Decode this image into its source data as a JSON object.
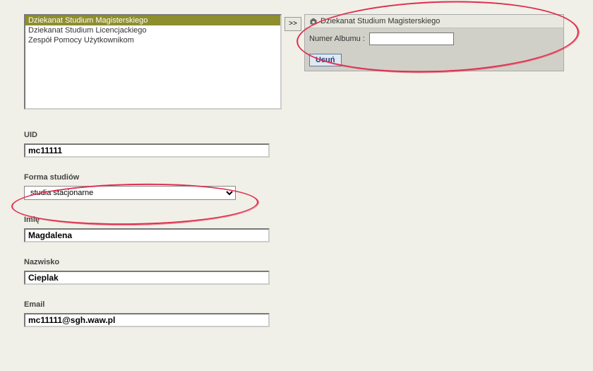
{
  "listbox": {
    "items": [
      {
        "label": "Dziekanat Studium Magisterskiego",
        "selected": true
      },
      {
        "label": "Dziekanat Studium Licencjackiego",
        "selected": false
      },
      {
        "label": "Zespół Pomocy Użytkownikom",
        "selected": false
      }
    ]
  },
  "move_button": {
    "label": ">>"
  },
  "right_panel": {
    "header_label": "Dziekanat Studium Magisterskiego",
    "album_label": "Numer Albumu :",
    "album_value": "",
    "delete_label": "Usuń"
  },
  "form": {
    "uid_label": "UID",
    "uid_value": "mc11111",
    "forma_label": "Forma studiów",
    "forma_value": "studia stacjonarne",
    "imie_label": "Imię",
    "imie_value": "Magdalena",
    "nazwisko_label": "Nazwisko",
    "nazwisko_value": "Cieplak",
    "email_label": "Email",
    "email_value": "mc11111@sgh.waw.pl"
  }
}
